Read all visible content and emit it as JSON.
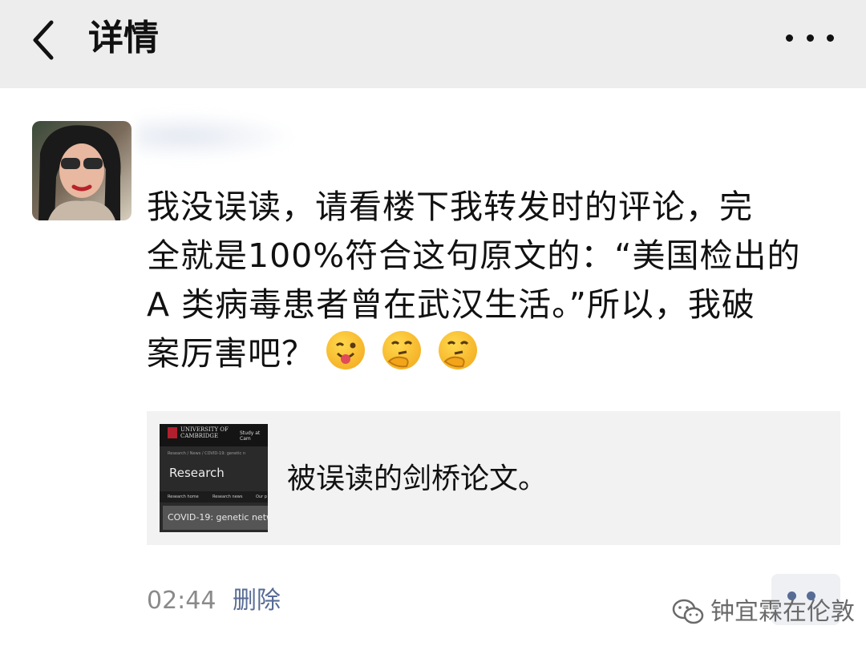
{
  "header": {
    "title": "详情",
    "back_icon": "chevron-left-icon",
    "more_icon": "more-horizontal-icon"
  },
  "post": {
    "text_lines": [
      "我没误读，请看楼下我转发时的评论，完",
      "全就是100%符合这句原文的：“美国检出的",
      "A 类病毒患者曾在武汉生活。”所以，我破",
      "案厉害吧？"
    ],
    "emojis": [
      "wink-tongue-emoji",
      "thinking-emoji",
      "thinking-emoji"
    ],
    "link": {
      "title": "被误读的剑桥论文。",
      "thumbnail": {
        "university": "UNIVERSITY OF CAMBRIDGE",
        "study": "Study at Cam",
        "crumbs": "Research / News / COVID-19: genetic n",
        "section": "Research",
        "tabs": [
          "Research home",
          "Research news",
          "Our p"
        ],
        "headline": "COVID-19: genetic netw"
      }
    },
    "time": "02:44",
    "delete_label": "删除"
  },
  "watermark": {
    "text": "钟宜霖在伦敦"
  },
  "colors": {
    "header_bg": "#ededed",
    "link_blue": "#576b95",
    "card_bg": "#f2f2f2",
    "time_gray": "#8a8a8a"
  }
}
